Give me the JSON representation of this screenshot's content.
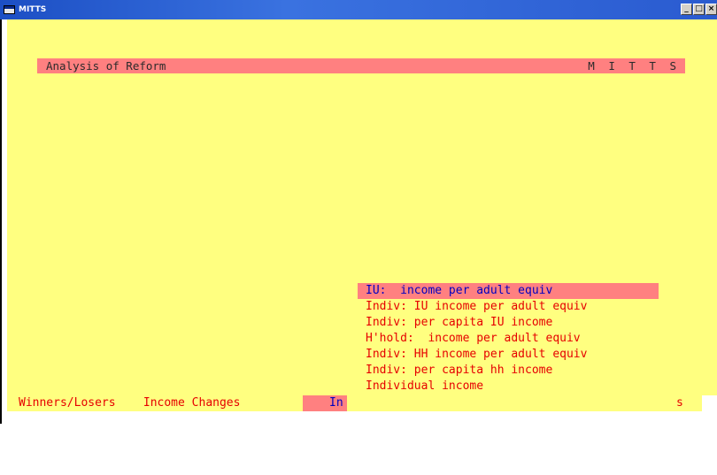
{
  "window": {
    "title": "MITTS"
  },
  "header": {
    "title": "Analysis of Reform",
    "brand": "M I T T S"
  },
  "menu": {
    "items": [
      "IU:  income per adult equiv",
      "Indiv: IU income per adult equiv",
      "Indiv: per capita IU income",
      "H'hold:  income per adult equiv",
      "Indiv: HH income per adult equiv",
      "Indiv: per capita hh income",
      "Individual income"
    ],
    "selected_index": 0
  },
  "statusbar": {
    "left": "Winners/Losers    Income Changes",
    "highlight": "In",
    "right": "s"
  },
  "colors": {
    "background": "#ffff80",
    "header_bar": "#ff8080",
    "menu_text": "#e60000",
    "selected_text": "#0000c0"
  }
}
